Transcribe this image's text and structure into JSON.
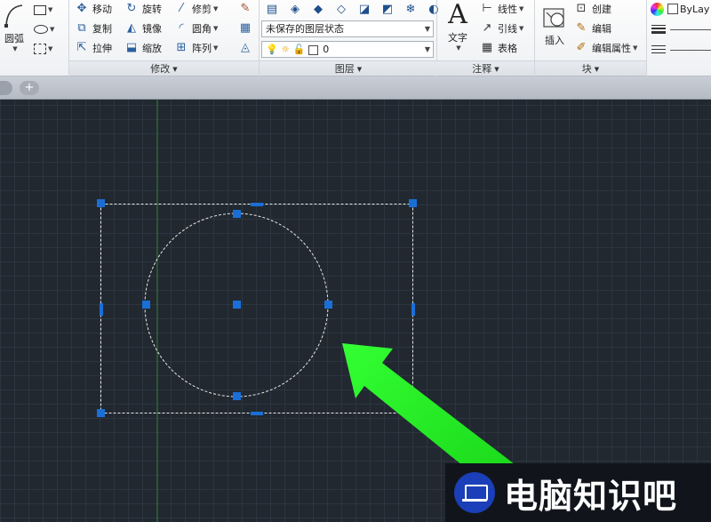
{
  "ribbon": {
    "draw": {
      "arc_label": "圆弧"
    },
    "modify": {
      "title": "修改",
      "move": "移动",
      "rotate": "旋转",
      "trim": "修剪",
      "copy": "复制",
      "mirror": "镜像",
      "fillet": "圆角",
      "stretch": "拉伸",
      "scale": "缩放",
      "array": "阵列"
    },
    "layers": {
      "title": "图层",
      "layer_state": "未保存的图层状态",
      "current_layer": "0"
    },
    "annotation": {
      "title": "注释",
      "text": "文字",
      "linear": "线性",
      "leader": "引线",
      "table": "表格"
    },
    "block": {
      "title": "块",
      "insert": "插入",
      "create": "创建",
      "edit": "编辑",
      "edit_attributes": "编辑属性"
    },
    "properties": {
      "color_value": "ByLay"
    }
  },
  "icons": {
    "move": "move-icon",
    "rotate": "rotate-icon",
    "trim": "trim-icon",
    "copy": "copy-icon",
    "mirror": "mirror-icon",
    "fillet": "fillet-icon",
    "stretch": "stretch-icon",
    "scale": "scale-icon",
    "array": "array-icon"
  },
  "colors": {
    "canvas_bg": "#212830",
    "grip": "#1a6fd6",
    "arrow": "#1fe01f",
    "selection_dash": "#ffffff"
  },
  "watermark": {
    "text": "电脑知识吧"
  }
}
